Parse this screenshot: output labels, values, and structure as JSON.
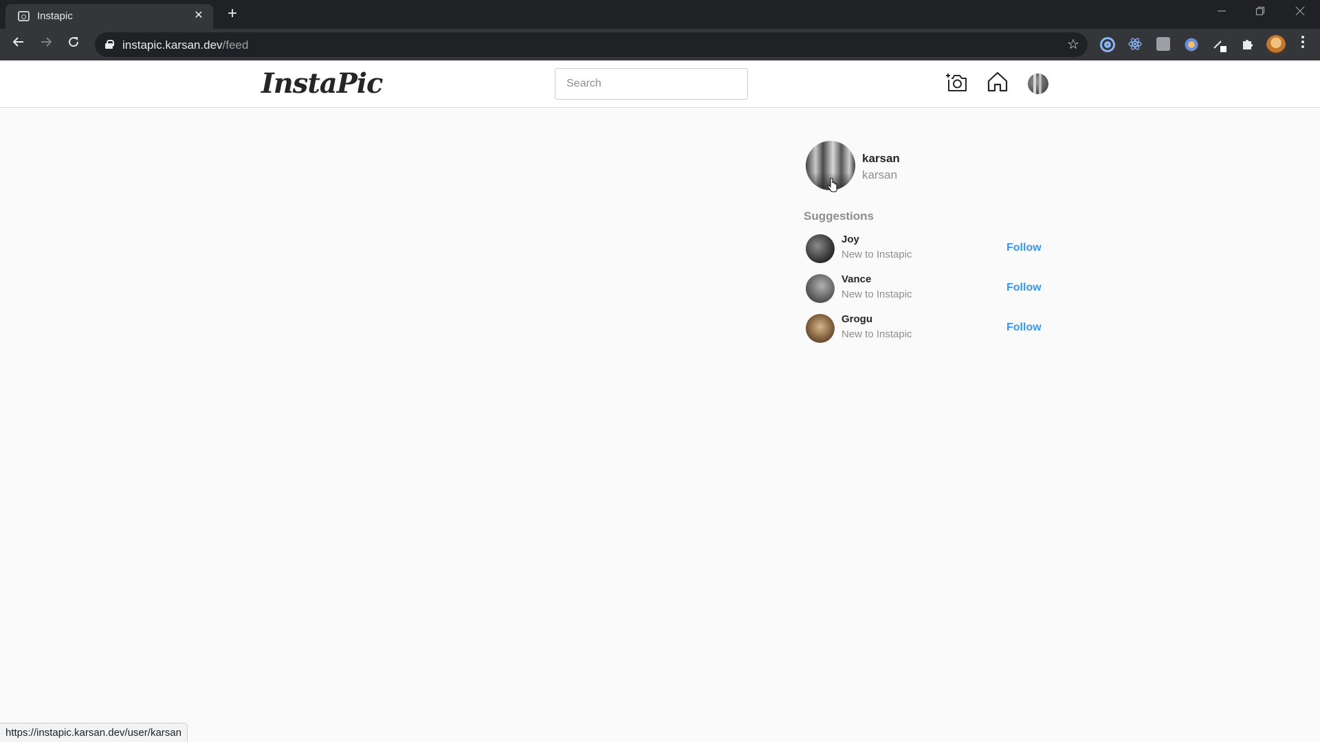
{
  "browser": {
    "tab_title": "Instapic",
    "tab_close": "✕",
    "new_tab": "+",
    "url_domain": "instapic.karsan.dev",
    "url_path": "/feed",
    "status_url": "https://instapic.karsan.dev/user/karsan"
  },
  "header": {
    "logo": "InstaPic",
    "search_placeholder": "Search"
  },
  "current_user": {
    "username": "karsan",
    "name": "karsan"
  },
  "suggestions": {
    "title": "Suggestions",
    "follow_label": "Follow",
    "items": [
      {
        "name": "Joy",
        "subtitle": "New to Instapic"
      },
      {
        "name": "Vance",
        "subtitle": "New to Instapic"
      },
      {
        "name": "Grogu",
        "subtitle": "New to Instapic"
      }
    ]
  },
  "colors": {
    "accent": "#3897f0",
    "page_bg": "#fafafa",
    "chrome_dark": "#202124"
  }
}
